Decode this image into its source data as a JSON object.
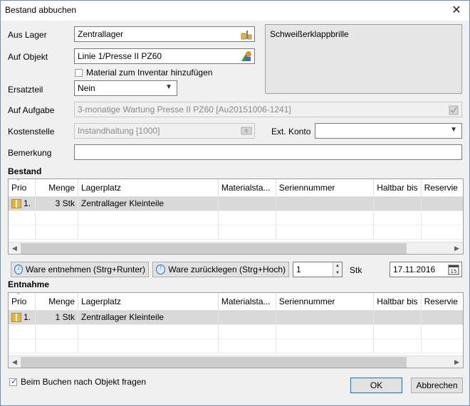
{
  "window": {
    "title": "Bestand abbuchen",
    "close": "✕"
  },
  "form": {
    "aus_lager": {
      "label": "Aus Lager",
      "value": "Zentrallager"
    },
    "auf_objekt": {
      "label": "Auf Objekt",
      "value": "Linie 1/Presse II PZ60"
    },
    "inventar_check": {
      "label": "Material zum Inventar hinzufügen",
      "checked": false
    },
    "ersatzteil": {
      "label": "Ersatzteil",
      "value": "Nein"
    },
    "auf_aufgabe": {
      "label": "Auf Aufgabe",
      "value": "3-monatige Wartung Presse II PZ60 [Au20151006-1241]"
    },
    "kostenstelle": {
      "label": "Kostenstelle",
      "value": "Instandhaltung [1000]"
    },
    "ext_konto": {
      "label": "Ext. Konto",
      "value": ""
    },
    "bemerkung": {
      "label": "Bemerkung",
      "value": ""
    },
    "info_text": "Schweißerklappbrille"
  },
  "bestand": {
    "title": "Bestand",
    "columns": [
      "Prio",
      "Menge",
      "Lagerplatz",
      "Materialsta...",
      "Seriennummer",
      "Haltbar bis",
      "Reservie"
    ],
    "rows": [
      {
        "prio": "1.",
        "menge": "3 Stk",
        "lagerplatz": "Zentrallager Kleinteile"
      }
    ]
  },
  "actions": {
    "entnehmen": "Ware entnehmen (Strg+Runter)",
    "zuruecklegen": "Ware zurücklegen (Strg+Hoch)",
    "quantity": "1",
    "unit": "Stk",
    "date": "17.11.2016"
  },
  "entnahme": {
    "title": "Entnahme",
    "columns": [
      "Prio",
      "Menge",
      "Lagerplatz",
      "Materialsta...",
      "Seriennummer",
      "Haltbar bis",
      "Reservie"
    ],
    "rows": [
      {
        "prio": "1.",
        "menge": "1 Stk",
        "lagerplatz": "Zentrallager Kleinteile"
      }
    ]
  },
  "footer": {
    "check_label": "Beim Buchen nach Objekt fragen",
    "checked": true,
    "ok": "OK",
    "cancel": "Abbrechen"
  },
  "colors": {
    "accent": "#0078d7",
    "selected_row": "#d9d9d9",
    "box_icon": "#e3b44b"
  }
}
